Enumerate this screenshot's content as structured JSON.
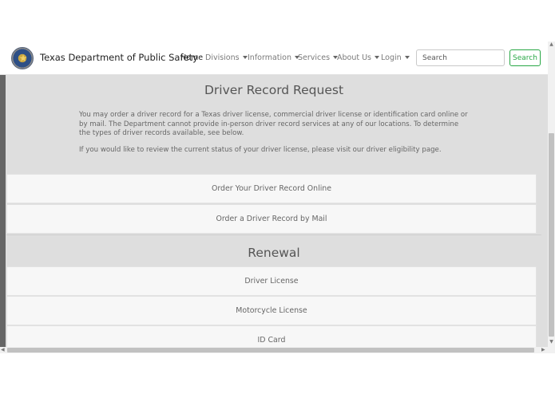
{
  "header": {
    "brand": "Texas Department of Public Safety",
    "logo_icon": "texas-dps-seal",
    "nav": [
      {
        "label": "Home",
        "dropdown": false,
        "active": true
      },
      {
        "label": "Divisions",
        "dropdown": true,
        "active": false
      },
      {
        "label": "Information",
        "dropdown": true,
        "active": false
      },
      {
        "label": "Services",
        "dropdown": true,
        "active": false
      },
      {
        "label": "About Us",
        "dropdown": true,
        "active": false
      },
      {
        "label": "Login",
        "dropdown": true,
        "active": false
      }
    ],
    "search": {
      "placeholder": "Search",
      "button_label": "Search"
    }
  },
  "driver_record": {
    "title": "Driver Record Request",
    "description": "You may order a driver record for a Texas driver license, commercial driver license or identification card online or by mail. The Department cannot provide in-person driver record services at any of our locations. To determine the types of driver records available, see below.",
    "note": "If you would like to review the current status of your driver license, please visit our driver eligibility page.",
    "options": [
      "Order Your Driver Record Online",
      "Order a Driver Record by Mail"
    ]
  },
  "renewal": {
    "title": "Renewal",
    "items": [
      "Driver License",
      "Motorcycle License",
      "ID Card"
    ]
  },
  "colors": {
    "accent_green": "#28a745",
    "section_gray": "#dedede",
    "item_background": "#f7f7f7"
  }
}
